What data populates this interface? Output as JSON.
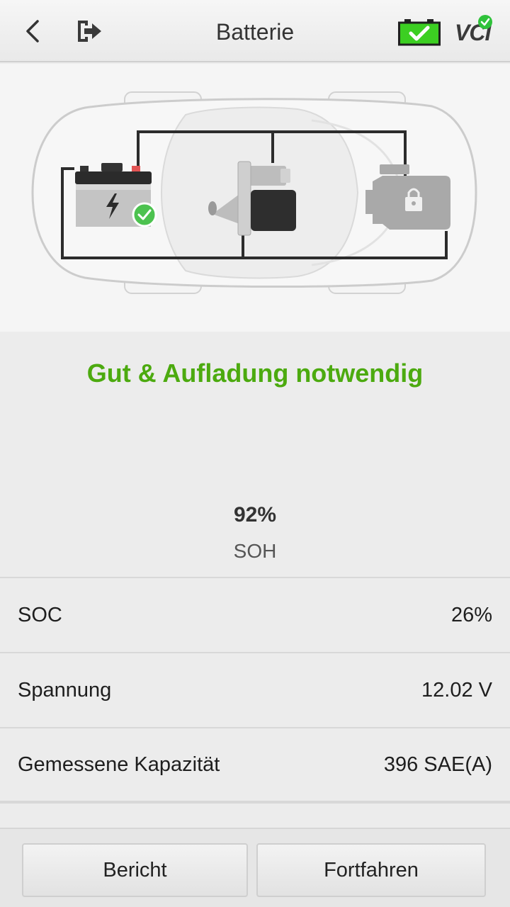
{
  "header": {
    "title": "Batterie",
    "back_icon": "chevron-left-icon",
    "exit_icon": "exit-icon",
    "battery_status_icon": "battery-ok-icon",
    "vci_label": "VCI",
    "vci_status_icon": "vci-connected-icon"
  },
  "illustration": {
    "components": [
      "battery-icon",
      "starter-motor-icon",
      "engine-locked-icon"
    ],
    "battery_status": "ok"
  },
  "status": {
    "text": "Gut & Aufladung notwendig",
    "color": "#4caa0f"
  },
  "gauge": {
    "value": "92%",
    "label": "SOH",
    "fraction": 0.92,
    "active_color": "#4caa0f",
    "inactive_color": "#bdbdbd"
  },
  "rows": [
    {
      "label": "SOC",
      "value": "26%"
    },
    {
      "label": "Spannung",
      "value": "12.02 V"
    },
    {
      "label": "Gemessene Kapazität",
      "value": "396 SAE(A)"
    }
  ],
  "footer": {
    "report_label": "Bericht",
    "continue_label": "Fortfahren"
  }
}
